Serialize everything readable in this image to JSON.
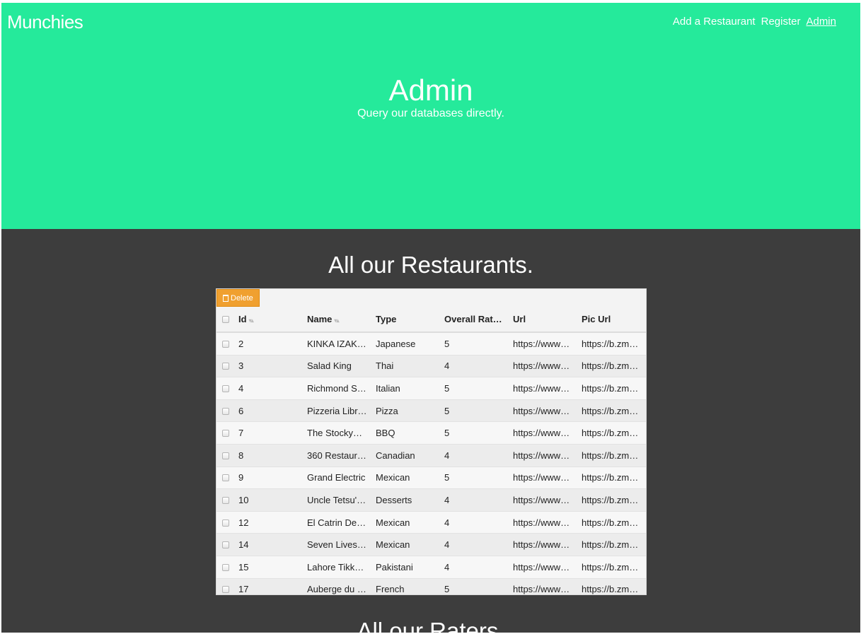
{
  "brand": "Munchies",
  "nav": {
    "add_restaurant": "Add a Restaurant",
    "register": "Register",
    "admin": "Admin"
  },
  "hero": {
    "title": "Admin",
    "subtitle": "Query our databases directly."
  },
  "restaurants_section": {
    "title": "All our Restaurants.",
    "delete_label": "Delete",
    "columns": [
      "Id",
      "Name",
      "Type",
      "Overall Rat…",
      "Url",
      "Pic Url"
    ],
    "rows": [
      {
        "id": "2",
        "name": "KINKA IZAK…",
        "type": "Japanese",
        "rating": "5",
        "url": "https://www…",
        "pic": "https://b.zm…"
      },
      {
        "id": "3",
        "name": "Salad King",
        "type": "Thai",
        "rating": "4",
        "url": "https://www…",
        "pic": "https://b.zm…"
      },
      {
        "id": "4",
        "name": "Richmond S…",
        "type": "Italian",
        "rating": "5",
        "url": "https://www…",
        "pic": "https://b.zm…"
      },
      {
        "id": "6",
        "name": "Pizzeria Libr…",
        "type": "Pizza",
        "rating": "5",
        "url": "https://www…",
        "pic": "https://b.zm…"
      },
      {
        "id": "7",
        "name": "The Stockya…",
        "type": "BBQ",
        "rating": "5",
        "url": "https://www…",
        "pic": "https://b.zm…"
      },
      {
        "id": "8",
        "name": "360 Restaur…",
        "type": "Canadian",
        "rating": "4",
        "url": "https://www…",
        "pic": "https://b.zm…"
      },
      {
        "id": "9",
        "name": "Grand Electric",
        "type": "Mexican",
        "rating": "5",
        "url": "https://www…",
        "pic": "https://b.zm…"
      },
      {
        "id": "10",
        "name": "Uncle Tetsu'…",
        "type": "Desserts",
        "rating": "4",
        "url": "https://www…",
        "pic": "https://b.zm…"
      },
      {
        "id": "12",
        "name": "El Catrin De…",
        "type": "Mexican",
        "rating": "4",
        "url": "https://www…",
        "pic": "https://b.zm…"
      },
      {
        "id": "14",
        "name": "Seven Lives …",
        "type": "Mexican",
        "rating": "4",
        "url": "https://www…",
        "pic": "https://b.zm…"
      },
      {
        "id": "15",
        "name": "Lahore Tikk…",
        "type": "Pakistani",
        "rating": "4",
        "url": "https://www…",
        "pic": "https://b.zm…"
      },
      {
        "id": "17",
        "name": "Auberge du …",
        "type": "French",
        "rating": "5",
        "url": "https://www…",
        "pic": "https://b.zm…"
      }
    ]
  },
  "raters_section": {
    "title": "All our Raters."
  },
  "colors": {
    "hero_bg": "#25ea9b",
    "dark_bg": "#3d3d3d",
    "delete_bg": "#f0a030"
  }
}
